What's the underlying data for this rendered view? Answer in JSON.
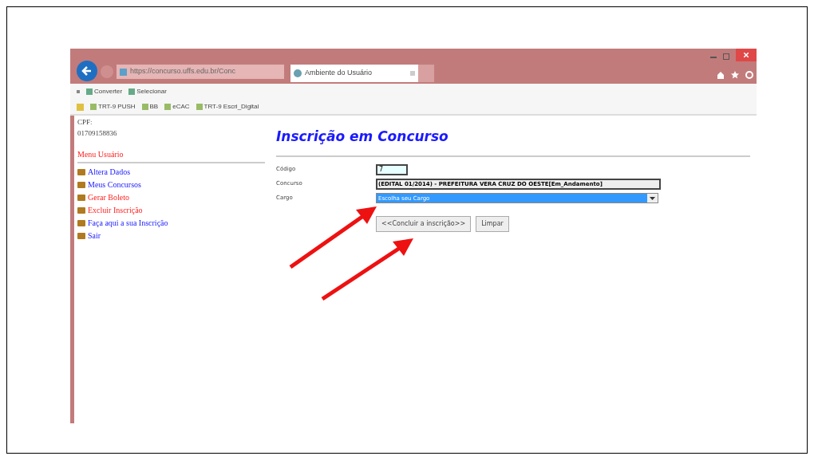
{
  "browser": {
    "address": "https://concurso.uffs.edu.br/Conc",
    "tab": {
      "label": "Ambiente do Usuário",
      "selected": true
    },
    "command_bar": [
      "Converter",
      "Selecionar"
    ],
    "favorites": [
      "TRT-9 PUSH",
      "BB",
      "eCAC",
      "TRT-9 Escri_Digital"
    ]
  },
  "sidebar": {
    "cpf_label": "CPF:",
    "cpf": "01709158836",
    "menu_title": "Menu Usuário",
    "items": [
      {
        "label": "Altera Dados",
        "visited": false
      },
      {
        "label": "Meus Concursos",
        "visited": false
      },
      {
        "label": "Gerar Boleto",
        "visited": true
      },
      {
        "label": "Excluir Inscrição",
        "visited": true
      },
      {
        "label": "Faça aqui a sua Inscrição",
        "visited": false
      },
      {
        "label": "Sair",
        "visited": false
      }
    ]
  },
  "form": {
    "title": "Inscrição em Concurso",
    "fields": [
      {
        "label": "Código",
        "kind": "input",
        "value": "7"
      },
      {
        "label": "Concurso",
        "kind": "readonly",
        "value": "(EDITAL 01/2014) - PREFEITURA VERA CRUZ DO OESTE[Em_Andamento]"
      },
      {
        "label": "Cargo",
        "kind": "select",
        "value": "Escolha seu Cargo"
      }
    ],
    "buttons": [
      "<<Concluir a inscrição>>",
      "Limpar"
    ]
  }
}
